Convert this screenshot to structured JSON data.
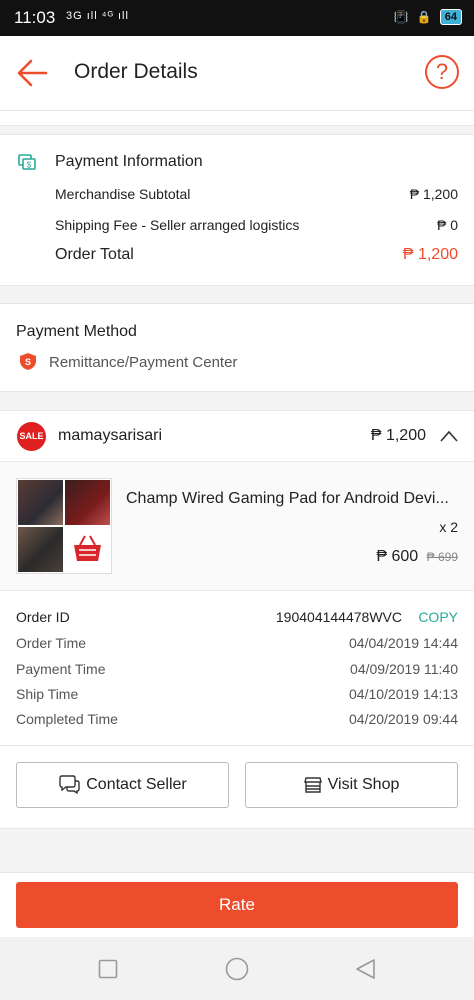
{
  "status_bar": {
    "time": "11:03",
    "signal": "3G ıll ⁴ᴳ ıll",
    "battery": "64"
  },
  "header": {
    "title": "Order Details",
    "help_icon": "?"
  },
  "payment_info": {
    "heading": "Payment Information",
    "rows": [
      {
        "label": "Merchandise Subtotal",
        "value": "₱ 1,200"
      },
      {
        "label": "Shipping Fee - Seller arranged logistics",
        "value": "₱ 0"
      }
    ],
    "total_label": "Order Total",
    "total_value": "₱ 1,200"
  },
  "payment_method": {
    "heading": "Payment Method",
    "method": "Remittance/Payment Center"
  },
  "shop": {
    "badge": "SALE",
    "name": "mamaysarisari",
    "amount": "₱ 1,200"
  },
  "product": {
    "name": "Champ Wired Gaming Pad for Android Devi...",
    "qty": "x 2",
    "price": "₱ 600",
    "original_price": "₱ 699"
  },
  "order_meta": [
    {
      "label": "Order ID",
      "value": "190404144478WVC"
    },
    {
      "label": "Order Time",
      "value": "04/04/2019 14:44"
    },
    {
      "label": "Payment Time",
      "value": "04/09/2019 11:40"
    },
    {
      "label": "Ship Time",
      "value": "04/10/2019 14:13"
    },
    {
      "label": "Completed Time",
      "value": "04/20/2019 09:44"
    }
  ],
  "copy_label": "COPY",
  "actions": {
    "contact_seller": "Contact Seller",
    "visit_shop": "Visit Shop",
    "rate": "Rate"
  },
  "colors": {
    "accent": "#ee4d2d",
    "copy": "#26aa99"
  }
}
